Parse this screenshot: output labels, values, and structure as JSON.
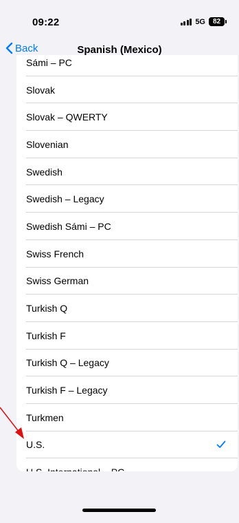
{
  "status_bar": {
    "time": "09:22",
    "network": "5G",
    "battery": "82"
  },
  "nav": {
    "back_label": "Back",
    "title": "Spanish (Mexico)"
  },
  "keyboards": [
    {
      "label": "Sámi – PC",
      "selected": false
    },
    {
      "label": "Slovak",
      "selected": false
    },
    {
      "label": "Slovak – QWERTY",
      "selected": false
    },
    {
      "label": "Slovenian",
      "selected": false
    },
    {
      "label": "Swedish",
      "selected": false
    },
    {
      "label": "Swedish – Legacy",
      "selected": false
    },
    {
      "label": "Swedish Sámi – PC",
      "selected": false
    },
    {
      "label": "Swiss French",
      "selected": false
    },
    {
      "label": "Swiss German",
      "selected": false
    },
    {
      "label": "Turkish Q",
      "selected": false
    },
    {
      "label": "Turkish F",
      "selected": false
    },
    {
      "label": "Turkish Q – Legacy",
      "selected": false
    },
    {
      "label": "Turkish F – Legacy",
      "selected": false
    },
    {
      "label": "Turkmen",
      "selected": false
    },
    {
      "label": "U.S.",
      "selected": true
    },
    {
      "label": "U.S. International – PC",
      "selected": false
    }
  ],
  "colors": {
    "accent": "#007aff",
    "annotation": "#e01010",
    "background": "#f2f2f7"
  }
}
